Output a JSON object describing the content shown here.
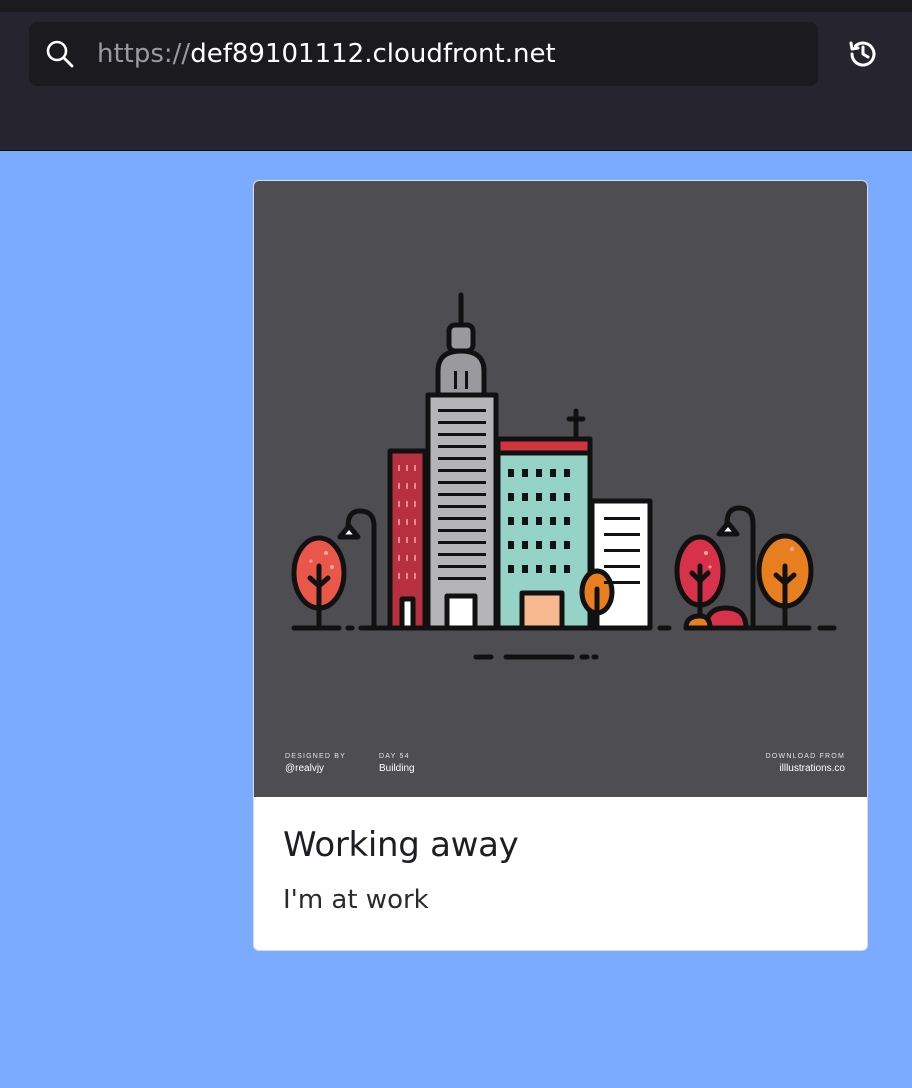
{
  "browser": {
    "url_scheme": "https://",
    "url_host": "def89101112.cloudfront.net",
    "icons": {
      "search": "search-icon",
      "history": "history-icon"
    }
  },
  "card": {
    "title": "Working away",
    "text": "I'm at work",
    "image": {
      "designed_by_caption": "DESIGNED BY",
      "designed_by_value": "@realvjy",
      "day_caption": "DAY 54",
      "day_value": "Building",
      "download_caption": "DOWNLOAD FROM",
      "download_value": "illlustrations.co"
    }
  },
  "colors": {
    "page_background": "#7aabff",
    "toolbar": "#26252f",
    "illustration_background": "#4e4d52"
  }
}
